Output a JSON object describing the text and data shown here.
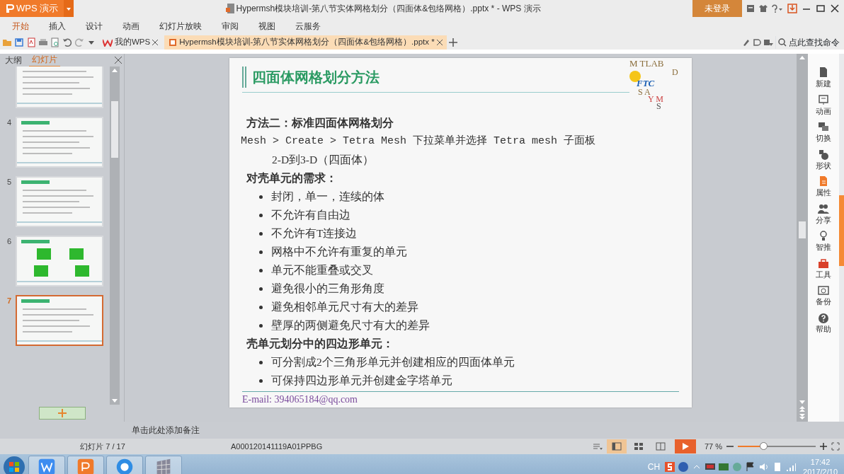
{
  "app_button": {
    "label": "WPS 演示"
  },
  "window_title": "Hypermsh模块培训-第八节实体网格划分（四面体&包络网格）.pptx * - WPS 演示",
  "login_button": "未登录",
  "menu_tabs": [
    {
      "label": "开始",
      "selected": true
    },
    {
      "label": "插入",
      "selected": false
    },
    {
      "label": "设计",
      "selected": false
    },
    {
      "label": "动画",
      "selected": false
    },
    {
      "label": "幻灯片放映",
      "selected": false
    },
    {
      "label": "审阅",
      "selected": false
    },
    {
      "label": "视图",
      "selected": false
    },
    {
      "label": "云服务",
      "selected": false
    }
  ],
  "doc_tabs": [
    {
      "label": "我的WPS",
      "selected": false
    },
    {
      "label": "Hypermsh模块培训-第八节实体网格划分（四面体&包络网格）.pptx *",
      "selected": true
    }
  ],
  "command_search": {
    "placeholder": "点此查找命令"
  },
  "panel_tabs": [
    {
      "label": "大纲",
      "selected": false
    },
    {
      "label": "幻灯片",
      "selected": true
    }
  ],
  "thumbnails": [
    {
      "selected": false
    },
    {
      "number": "4",
      "selected": false
    },
    {
      "number": "5",
      "selected": false
    },
    {
      "number": "6",
      "selected": false
    },
    {
      "number": "7",
      "selected": true
    }
  ],
  "slide": {
    "title": "四面体网格划分方法",
    "logo": {
      "top": "M TLAB",
      "side": "D",
      "mid": "FTC",
      "low": "S  A",
      "bottom": "Y M",
      "last": "S"
    },
    "lines": [
      {
        "kind": "heading",
        "text": "方法二：标准四面体网格划分"
      },
      {
        "kind": "plain",
        "text": "Mesh > Create > Tetra Mesh 下拉菜单并选择 Tetra mesh 子面板"
      },
      {
        "kind": "indent",
        "text": "2-D到3-D（四面体）"
      },
      {
        "kind": "heading",
        "text": "对壳单元的需求："
      },
      {
        "kind": "bullet",
        "text": "封闭，单一，连续的体"
      },
      {
        "kind": "bullet",
        "text": "不允许有自由边"
      },
      {
        "kind": "bullet",
        "text": "不允许有T连接边"
      },
      {
        "kind": "bullet",
        "text": "网格中不允许有重复的单元"
      },
      {
        "kind": "bullet",
        "text": "单元不能重叠或交叉"
      },
      {
        "kind": "bullet",
        "text": "避免很小的三角形角度"
      },
      {
        "kind": "bullet",
        "text": "避免相邻单元尺寸有大的差异"
      },
      {
        "kind": "bullet",
        "text": "壁厚的两侧避免尺寸有大的差异"
      },
      {
        "kind": "heading",
        "text": "壳单元划分中的四边形单元："
      },
      {
        "kind": "bullet",
        "text": "可分割成2个三角形单元并创建相应的四面体单元"
      },
      {
        "kind": "bullet",
        "text": "可保持四边形单元并创建金字塔单元"
      }
    ],
    "email": "E-mail: 394065184@qq.com"
  },
  "notes": {
    "placeholder": "单击此处添加备注"
  },
  "right_sidebar": [
    {
      "label": "新建",
      "kind": "doc"
    },
    {
      "label": "动画",
      "kind": "anim"
    },
    {
      "label": "切换",
      "kind": "switch"
    },
    {
      "label": "形状",
      "kind": "shape"
    },
    {
      "label": "属性",
      "kind": "prop"
    },
    {
      "label": "分享",
      "kind": "share"
    },
    {
      "label": "智推",
      "kind": "bulb"
    },
    {
      "label": "工具",
      "kind": "tool"
    },
    {
      "label": "备份",
      "kind": "backup"
    },
    {
      "label": "帮助",
      "kind": "help"
    }
  ],
  "status_bar": {
    "slide_count": "幻灯片 7 / 17",
    "template": "A000120141119A01PPBG",
    "zoom": "77 %",
    "level": 0.33
  },
  "taskbar": {
    "ime": "CH",
    "time": "17:42",
    "date": "2017/2/10"
  }
}
